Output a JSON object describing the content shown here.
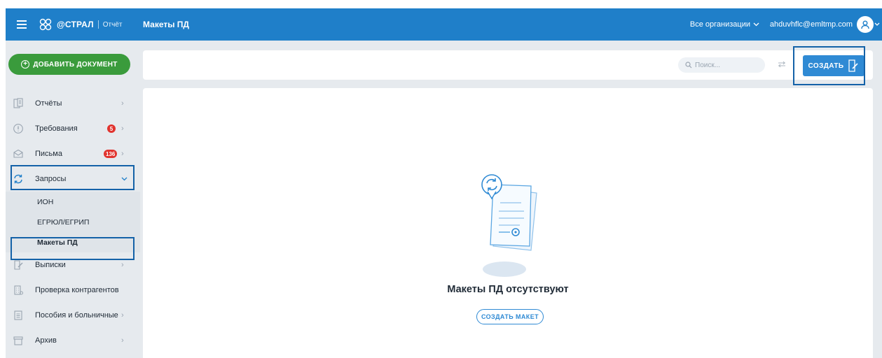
{
  "topbar": {
    "logo_text": "@СТРАЛ",
    "logo_sub": "Отчёт",
    "page_title": "Макеты ПД",
    "org_select": "Все организации",
    "user_email": "ahduvhflc@emltmp.com"
  },
  "sidebar": {
    "add_document": "ДОБАВИТЬ ДОКУМЕНТ",
    "items": [
      {
        "label": "Отчёты",
        "icon": "report-icon"
      },
      {
        "label": "Требования",
        "icon": "alert-circle-icon",
        "badge": "5"
      },
      {
        "label": "Письма",
        "icon": "envelope-icon",
        "badge": "136"
      },
      {
        "label": "Запросы",
        "icon": "refresh-icon"
      },
      {
        "label": "Выписки",
        "icon": "document-edit-icon"
      },
      {
        "label": "Проверка контрагентов",
        "icon": "building-icon"
      },
      {
        "label": "Пособия и больничные",
        "icon": "clipboard-icon"
      },
      {
        "label": "Архив",
        "icon": "archive-icon"
      }
    ],
    "sub_items": [
      {
        "label": "ИОН"
      },
      {
        "label": "ЕГРЮЛ/ЕГРИП"
      },
      {
        "label": "Макеты ПД"
      }
    ]
  },
  "toolbar": {
    "search_placeholder": "Поиск...",
    "create_label": "СОЗДАТЬ"
  },
  "content": {
    "empty_title": "Макеты ПД отсутствуют",
    "create_template_label": "СОЗДАТЬ МАКЕТ"
  },
  "colors": {
    "header": "#1f7fc9",
    "accent": "#2f8ad4",
    "add_button": "#3a9b3c",
    "badge": "#e1332e",
    "highlight": "#1462a8"
  }
}
